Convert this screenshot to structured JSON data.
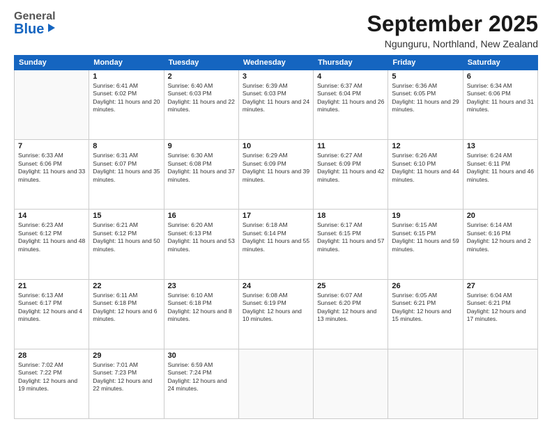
{
  "header": {
    "logo": {
      "general": "General",
      "blue": "Blue"
    },
    "title": "September 2025",
    "location": "Ngunguru, Northland, New Zealand"
  },
  "days": [
    "Sunday",
    "Monday",
    "Tuesday",
    "Wednesday",
    "Thursday",
    "Friday",
    "Saturday"
  ],
  "weeks": [
    [
      {
        "day": "",
        "sunrise": "",
        "sunset": "",
        "daylight": ""
      },
      {
        "day": "1",
        "sunrise": "Sunrise: 6:41 AM",
        "sunset": "Sunset: 6:02 PM",
        "daylight": "Daylight: 11 hours and 20 minutes."
      },
      {
        "day": "2",
        "sunrise": "Sunrise: 6:40 AM",
        "sunset": "Sunset: 6:03 PM",
        "daylight": "Daylight: 11 hours and 22 minutes."
      },
      {
        "day": "3",
        "sunrise": "Sunrise: 6:39 AM",
        "sunset": "Sunset: 6:03 PM",
        "daylight": "Daylight: 11 hours and 24 minutes."
      },
      {
        "day": "4",
        "sunrise": "Sunrise: 6:37 AM",
        "sunset": "Sunset: 6:04 PM",
        "daylight": "Daylight: 11 hours and 26 minutes."
      },
      {
        "day": "5",
        "sunrise": "Sunrise: 6:36 AM",
        "sunset": "Sunset: 6:05 PM",
        "daylight": "Daylight: 11 hours and 29 minutes."
      },
      {
        "day": "6",
        "sunrise": "Sunrise: 6:34 AM",
        "sunset": "Sunset: 6:06 PM",
        "daylight": "Daylight: 11 hours and 31 minutes."
      }
    ],
    [
      {
        "day": "7",
        "sunrise": "Sunrise: 6:33 AM",
        "sunset": "Sunset: 6:06 PM",
        "daylight": "Daylight: 11 hours and 33 minutes."
      },
      {
        "day": "8",
        "sunrise": "Sunrise: 6:31 AM",
        "sunset": "Sunset: 6:07 PM",
        "daylight": "Daylight: 11 hours and 35 minutes."
      },
      {
        "day": "9",
        "sunrise": "Sunrise: 6:30 AM",
        "sunset": "Sunset: 6:08 PM",
        "daylight": "Daylight: 11 hours and 37 minutes."
      },
      {
        "day": "10",
        "sunrise": "Sunrise: 6:29 AM",
        "sunset": "Sunset: 6:09 PM",
        "daylight": "Daylight: 11 hours and 39 minutes."
      },
      {
        "day": "11",
        "sunrise": "Sunrise: 6:27 AM",
        "sunset": "Sunset: 6:09 PM",
        "daylight": "Daylight: 11 hours and 42 minutes."
      },
      {
        "day": "12",
        "sunrise": "Sunrise: 6:26 AM",
        "sunset": "Sunset: 6:10 PM",
        "daylight": "Daylight: 11 hours and 44 minutes."
      },
      {
        "day": "13",
        "sunrise": "Sunrise: 6:24 AM",
        "sunset": "Sunset: 6:11 PM",
        "daylight": "Daylight: 11 hours and 46 minutes."
      }
    ],
    [
      {
        "day": "14",
        "sunrise": "Sunrise: 6:23 AM",
        "sunset": "Sunset: 6:12 PM",
        "daylight": "Daylight: 11 hours and 48 minutes."
      },
      {
        "day": "15",
        "sunrise": "Sunrise: 6:21 AM",
        "sunset": "Sunset: 6:12 PM",
        "daylight": "Daylight: 11 hours and 50 minutes."
      },
      {
        "day": "16",
        "sunrise": "Sunrise: 6:20 AM",
        "sunset": "Sunset: 6:13 PM",
        "daylight": "Daylight: 11 hours and 53 minutes."
      },
      {
        "day": "17",
        "sunrise": "Sunrise: 6:18 AM",
        "sunset": "Sunset: 6:14 PM",
        "daylight": "Daylight: 11 hours and 55 minutes."
      },
      {
        "day": "18",
        "sunrise": "Sunrise: 6:17 AM",
        "sunset": "Sunset: 6:15 PM",
        "daylight": "Daylight: 11 hours and 57 minutes."
      },
      {
        "day": "19",
        "sunrise": "Sunrise: 6:15 AM",
        "sunset": "Sunset: 6:15 PM",
        "daylight": "Daylight: 11 hours and 59 minutes."
      },
      {
        "day": "20",
        "sunrise": "Sunrise: 6:14 AM",
        "sunset": "Sunset: 6:16 PM",
        "daylight": "Daylight: 12 hours and 2 minutes."
      }
    ],
    [
      {
        "day": "21",
        "sunrise": "Sunrise: 6:13 AM",
        "sunset": "Sunset: 6:17 PM",
        "daylight": "Daylight: 12 hours and 4 minutes."
      },
      {
        "day": "22",
        "sunrise": "Sunrise: 6:11 AM",
        "sunset": "Sunset: 6:18 PM",
        "daylight": "Daylight: 12 hours and 6 minutes."
      },
      {
        "day": "23",
        "sunrise": "Sunrise: 6:10 AM",
        "sunset": "Sunset: 6:18 PM",
        "daylight": "Daylight: 12 hours and 8 minutes."
      },
      {
        "day": "24",
        "sunrise": "Sunrise: 6:08 AM",
        "sunset": "Sunset: 6:19 PM",
        "daylight": "Daylight: 12 hours and 10 minutes."
      },
      {
        "day": "25",
        "sunrise": "Sunrise: 6:07 AM",
        "sunset": "Sunset: 6:20 PM",
        "daylight": "Daylight: 12 hours and 13 minutes."
      },
      {
        "day": "26",
        "sunrise": "Sunrise: 6:05 AM",
        "sunset": "Sunset: 6:21 PM",
        "daylight": "Daylight: 12 hours and 15 minutes."
      },
      {
        "day": "27",
        "sunrise": "Sunrise: 6:04 AM",
        "sunset": "Sunset: 6:21 PM",
        "daylight": "Daylight: 12 hours and 17 minutes."
      }
    ],
    [
      {
        "day": "28",
        "sunrise": "Sunrise: 7:02 AM",
        "sunset": "Sunset: 7:22 PM",
        "daylight": "Daylight: 12 hours and 19 minutes."
      },
      {
        "day": "29",
        "sunrise": "Sunrise: 7:01 AM",
        "sunset": "Sunset: 7:23 PM",
        "daylight": "Daylight: 12 hours and 22 minutes."
      },
      {
        "day": "30",
        "sunrise": "Sunrise: 6:59 AM",
        "sunset": "Sunset: 7:24 PM",
        "daylight": "Daylight: 12 hours and 24 minutes."
      },
      {
        "day": "",
        "sunrise": "",
        "sunset": "",
        "daylight": ""
      },
      {
        "day": "",
        "sunrise": "",
        "sunset": "",
        "daylight": ""
      },
      {
        "day": "",
        "sunrise": "",
        "sunset": "",
        "daylight": ""
      },
      {
        "day": "",
        "sunrise": "",
        "sunset": "",
        "daylight": ""
      }
    ]
  ]
}
